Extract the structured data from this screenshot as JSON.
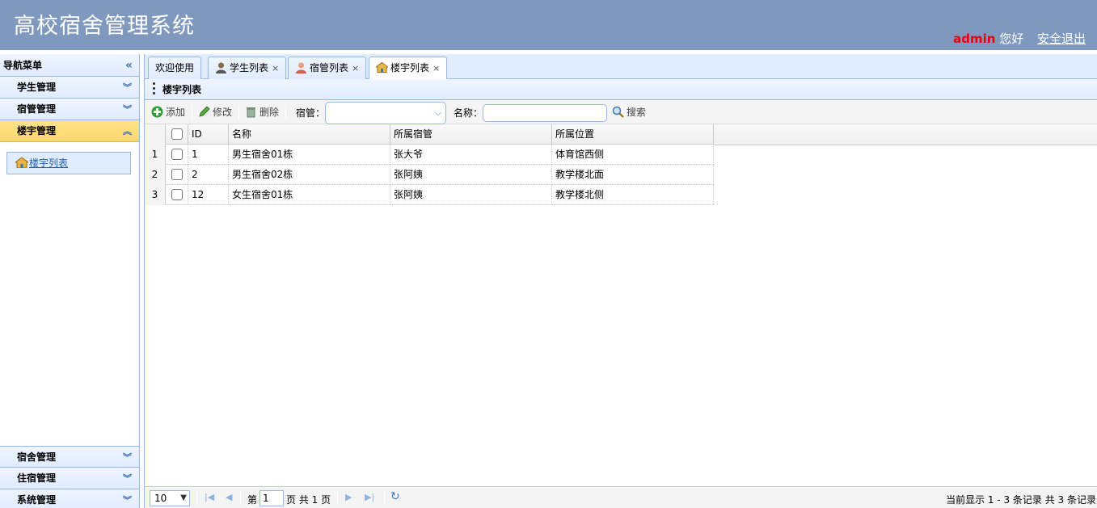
{
  "header": {
    "title": "高校宿舍管理系统",
    "username": "admin",
    "greeting": "您好",
    "logout": "安全退出"
  },
  "sidebar": {
    "title": "导航菜单",
    "items_top": [
      {
        "label": "学生管理"
      },
      {
        "label": "宿管管理"
      },
      {
        "label": "楼宇管理"
      }
    ],
    "sub_item": "楼宇列表",
    "items_bottom": [
      {
        "label": "宿舍管理"
      },
      {
        "label": "住宿管理"
      },
      {
        "label": "系统管理"
      }
    ]
  },
  "tabs": [
    {
      "label": "欢迎使用"
    },
    {
      "label": "学生列表"
    },
    {
      "label": "宿管列表"
    },
    {
      "label": "楼宇列表"
    }
  ],
  "panel_title": "楼宇列表",
  "toolbar": {
    "add": "添加",
    "edit": "修改",
    "delete": "删除",
    "manager_label": "宿管：",
    "manager_value": "",
    "name_label": "名称：",
    "name_value": "",
    "search": "搜索"
  },
  "grid": {
    "columns": [
      "ID",
      "名称",
      "所属宿管",
      "所属位置"
    ],
    "rows": [
      {
        "num": "1",
        "id": "1",
        "name": "男生宿舍01栋",
        "manager": "张大爷",
        "location": "体育馆西侧"
      },
      {
        "num": "2",
        "id": "2",
        "name": "男生宿舍02栋",
        "manager": "张阿姨",
        "location": "教学楼北面"
      },
      {
        "num": "3",
        "id": "12",
        "name": "女生宿舍01栋",
        "manager": "张阿姨",
        "location": "教学楼北侧"
      }
    ]
  },
  "pager": {
    "page_size": "10",
    "page_prefix": "第",
    "page_number": "1",
    "page_suffix": "页 共 1 页",
    "info": "当前显示 1 - 3 条记录 共 3 条记录"
  },
  "colors": {
    "header_bg": "#7f99be",
    "accent_border": "#95b8e7",
    "selected_bg": "#ffe48d",
    "username": "#e8000b"
  }
}
